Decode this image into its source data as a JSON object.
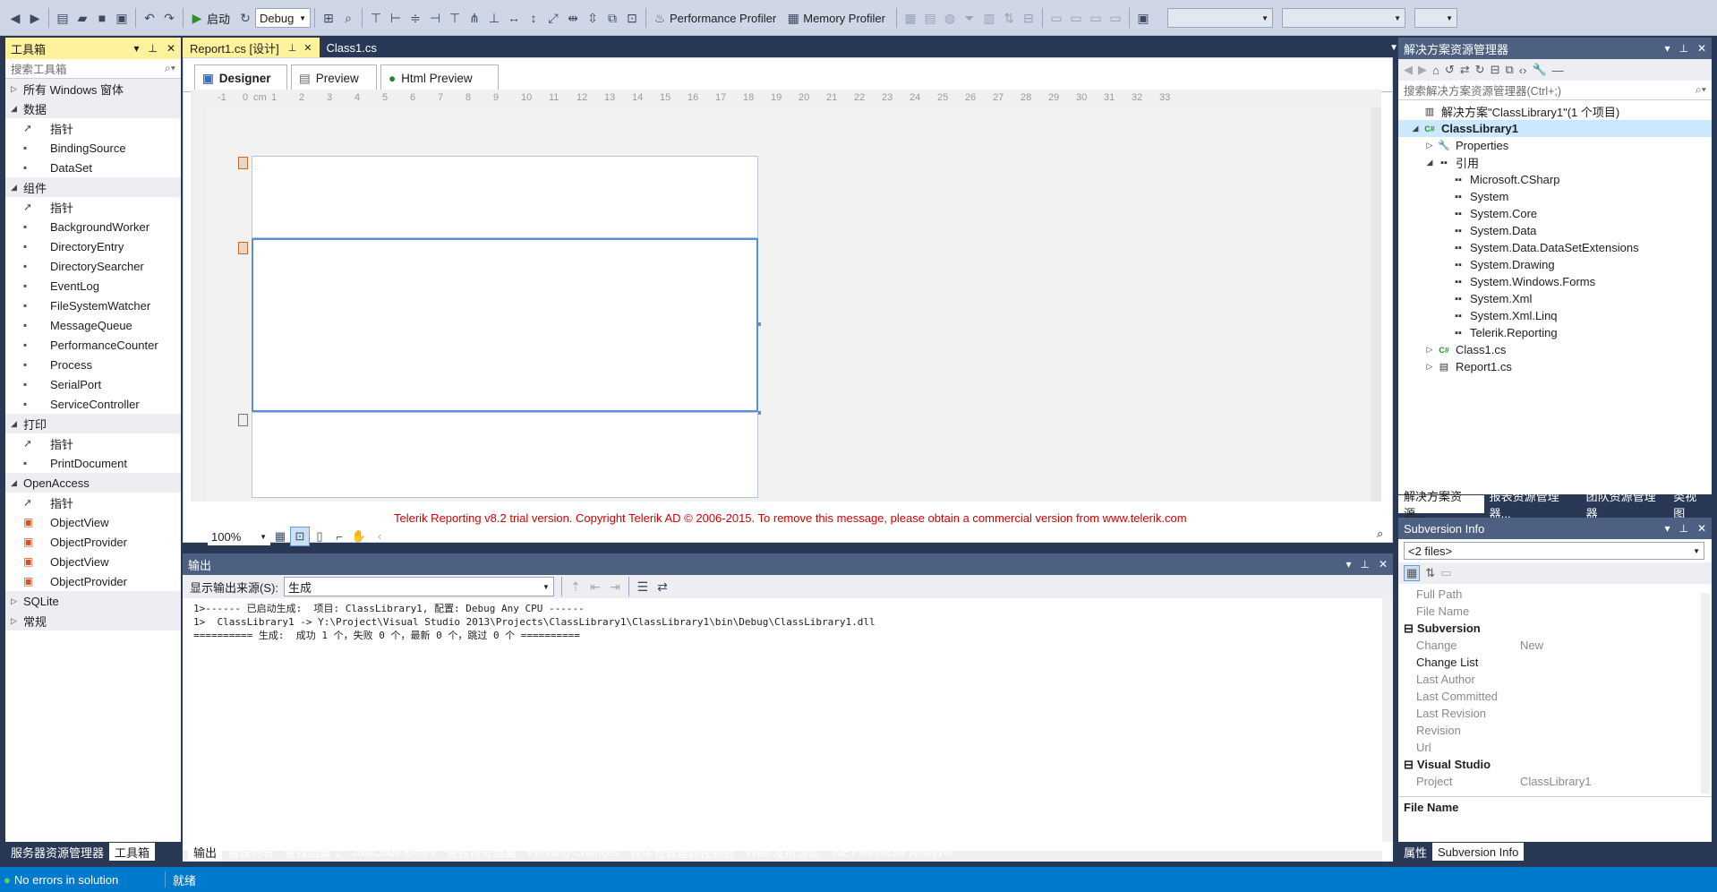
{
  "toolbar": {
    "config": "Debug",
    "start_label": "启动",
    "perf_profiler": "Performance Profiler",
    "memory_profiler": "Memory Profiler"
  },
  "toolbox": {
    "title": "工具箱",
    "search_placeholder": "搜索工具箱",
    "groups": [
      {
        "label": "所有 Windows 窗体",
        "expanded": false,
        "items": []
      },
      {
        "label": "数据",
        "expanded": true,
        "items": [
          "指针",
          "BindingSource",
          "DataSet"
        ]
      },
      {
        "label": "组件",
        "expanded": true,
        "items": [
          "指针",
          "BackgroundWorker",
          "DirectoryEntry",
          "DirectorySearcher",
          "EventLog",
          "FileSystemWatcher",
          "MessageQueue",
          "PerformanceCounter",
          "Process",
          "SerialPort",
          "ServiceController"
        ]
      },
      {
        "label": "打印",
        "expanded": true,
        "items": [
          "指针",
          "PrintDocument"
        ]
      },
      {
        "label": "OpenAccess",
        "expanded": true,
        "items": [
          "指针",
          "ObjectView",
          "ObjectProvider",
          "ObjectView",
          "ObjectProvider"
        ]
      },
      {
        "label": "SQLite",
        "expanded": false,
        "items": []
      },
      {
        "label": "常规",
        "expanded": false,
        "items": []
      }
    ],
    "bottom_tabs": [
      "服务器资源管理器",
      "工具箱"
    ]
  },
  "doc_tabs": [
    "Report1.cs [设计]",
    "Class1.cs"
  ],
  "report_tabs": [
    "Designer",
    "Preview",
    "Html Preview"
  ],
  "ruler_labels": [
    "-1",
    "0",
    "cm",
    "1",
    "2",
    "3",
    "4",
    "5",
    "6",
    "7",
    "8",
    "9",
    "10",
    "11",
    "12",
    "13",
    "14",
    "15",
    "16",
    "17",
    "18",
    "19",
    "20",
    "21",
    "22",
    "23",
    "24",
    "25",
    "26",
    "27",
    "28",
    "29",
    "30",
    "31",
    "32",
    "33"
  ],
  "trial_message": "Telerik Reporting v8.2 trial version. Copyright Telerik AD © 2006-2015. To remove this message, please obtain a commercial version from www.telerik.com",
  "zoom": "100%",
  "output": {
    "title": "输出",
    "source_label": "显示输出来源(S):",
    "source_value": "生成",
    "lines": [
      "1>------ 已启动生成:  项目: ClassLibrary1, 配置: Debug Any CPU ------",
      "1>  ClassLibrary1 -> Y:\\Project\\Visual Studio 2013\\Projects\\ClassLibrary1\\ClassLibrary1\\bin\\Debug\\ClassLibrary1.dll",
      "========== 生成:  成功 1 个，失败 0 个，最新 0 个，跳过 0 个 =========="
    ],
    "bottom_tabs": [
      "输出",
      "错误列表",
      "查找结果 1",
      "JustCode Errors",
      "查找符号结果",
      "Pending Changes",
      "程序包管理器控制台",
      "Web 发布活动",
      ".NET Reflector Analyzer"
    ]
  },
  "solution_explorer": {
    "title": "解决方案资源管理器",
    "search_placeholder": "搜索解决方案资源管理器(Ctrl+;)",
    "nodes": [
      {
        "label": "解决方案\"ClassLibrary1\"(1 个项目)",
        "level": 0,
        "arrow": "",
        "icon": "solution-icon",
        "bold": false
      },
      {
        "label": "ClassLibrary1",
        "level": 0,
        "arrow": "◢",
        "icon": "csproj-icon",
        "bold": true
      },
      {
        "label": "Properties",
        "level": 1,
        "arrow": "▷",
        "icon": "wrench-icon",
        "bold": false
      },
      {
        "label": "引用",
        "level": 1,
        "arrow": "◢",
        "icon": "references-icon",
        "bold": false
      },
      {
        "label": "Microsoft.CSharp",
        "level": 2,
        "arrow": "",
        "icon": "assembly-icon",
        "bold": false
      },
      {
        "label": "System",
        "level": 2,
        "arrow": "",
        "icon": "assembly-icon",
        "bold": false
      },
      {
        "label": "System.Core",
        "level": 2,
        "arrow": "",
        "icon": "assembly-icon",
        "bold": false
      },
      {
        "label": "System.Data",
        "level": 2,
        "arrow": "",
        "icon": "assembly-icon",
        "bold": false
      },
      {
        "label": "System.Data.DataSetExtensions",
        "level": 2,
        "arrow": "",
        "icon": "assembly-icon",
        "bold": false
      },
      {
        "label": "System.Drawing",
        "level": 2,
        "arrow": "",
        "icon": "assembly-icon",
        "bold": false
      },
      {
        "label": "System.Windows.Forms",
        "level": 2,
        "arrow": "",
        "icon": "assembly-icon",
        "bold": false
      },
      {
        "label": "System.Xml",
        "level": 2,
        "arrow": "",
        "icon": "assembly-icon",
        "bold": false
      },
      {
        "label": "System.Xml.Linq",
        "level": 2,
        "arrow": "",
        "icon": "assembly-icon",
        "bold": false
      },
      {
        "label": "Telerik.Reporting",
        "level": 2,
        "arrow": "",
        "icon": "assembly-icon",
        "bold": false
      },
      {
        "label": "Class1.cs",
        "level": 1,
        "arrow": "▷",
        "icon": "csharp-file-icon",
        "bold": false
      },
      {
        "label": "Report1.cs",
        "level": 1,
        "arrow": "▷",
        "icon": "report-file-icon",
        "bold": false
      }
    ],
    "bottom_tabs": [
      "解决方案资源...",
      "报表资源管理器...",
      "团队资源管理器",
      "类视图"
    ]
  },
  "subversion": {
    "title": "Subversion Info",
    "selector": "<2 files>",
    "rows": [
      {
        "type": "prop",
        "key": "Full Path",
        "value": ""
      },
      {
        "type": "prop",
        "key": "File Name",
        "value": ""
      },
      {
        "type": "cat",
        "key": "Subversion"
      },
      {
        "type": "prop",
        "key": "Change",
        "value": "New"
      },
      {
        "type": "prop",
        "key": "Change List",
        "value": "",
        "dark": true
      },
      {
        "type": "prop",
        "key": "Last Author",
        "value": ""
      },
      {
        "type": "prop",
        "key": "Last Committed",
        "value": ""
      },
      {
        "type": "prop",
        "key": "Last Revision",
        "value": ""
      },
      {
        "type": "prop",
        "key": "Revision",
        "value": ""
      },
      {
        "type": "prop",
        "key": "Url",
        "value": ""
      },
      {
        "type": "cat",
        "key": "Visual Studio"
      },
      {
        "type": "prop",
        "key": "Project",
        "value": "ClassLibrary1"
      }
    ],
    "desc_title": "File Name",
    "bottom_tabs": [
      "属性",
      "Subversion Info"
    ]
  },
  "status": {
    "errors": "No errors in solution",
    "ready": "就绪"
  },
  "colors": {
    "accent": "#007acc",
    "active_tab": "#fff29d",
    "frame": "#293955",
    "trial_text": "#d40000"
  }
}
